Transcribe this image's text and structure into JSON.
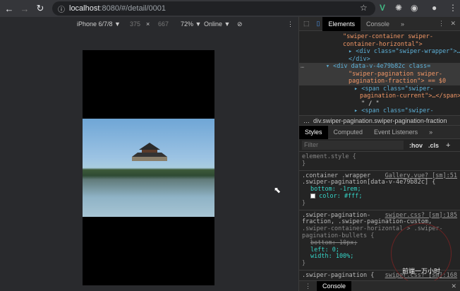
{
  "browser": {
    "url_host": "localhost",
    "url_path": ":8080/#/detail/0001"
  },
  "device_toolbar": {
    "device": "iPhone 6/7/8 ▼",
    "width": "375",
    "x": "×",
    "height": "667",
    "zoom": "72% ▼",
    "network": "Online ▼"
  },
  "devtools": {
    "tabs": [
      "Elements",
      "Console",
      "»"
    ],
    "dom": [
      "\"swiper-container swiper-",
      "container-horizontal\">",
      "<div class=\"swiper-wrapper\">…",
      "</div>",
      "<div data-v-4e79b82c class=",
      "\"swiper-pagination swiper-",
      "pagination-fraction\"> == $0",
      "<span class=\"swiper-",
      "pagination-current\">…</span>",
      "\" / \"",
      "<span class=\"swiper-"
    ],
    "breadcrumb": "div.swiper-pagination.swiper-pagination-fraction",
    "style_tabs": [
      "Styles",
      "Computed",
      "Event Listeners",
      "»"
    ],
    "filter_placeholder": "Filter",
    "hov": ":hov",
    "cls": ".cls",
    "plus": "+",
    "rules": {
      "r0": {
        "sel": "element.style {",
        "close": "}"
      },
      "r1": {
        "sel1": ".container .wrapper",
        "sel2": ".swiper-pagination[data-v-4e79b82c] {",
        "src": "Gallery.vue? [sm]:51",
        "p1": "bottom: -1rem;",
        "p2": "color: #fff;",
        "close": "}"
      },
      "r2": {
        "sel1": ".swiper-pagination-",
        "sel2": "fraction, .swiper-pagination-custom,",
        "sel3": ".swiper-container-horizontal > .swiper-",
        "sel4": "pagination-bullets {",
        "src": "swiper.css? [sm]:185",
        "p1": "bottom: 10px;",
        "p2": "left: 0;",
        "p3": "width: 100%;",
        "close": "}"
      },
      "r3": {
        "sel": ".swiper-pagination {",
        "src": "swiper.css? [sm]:168"
      }
    },
    "console_drawer": "Console",
    "watermark": "前端一万小时"
  }
}
